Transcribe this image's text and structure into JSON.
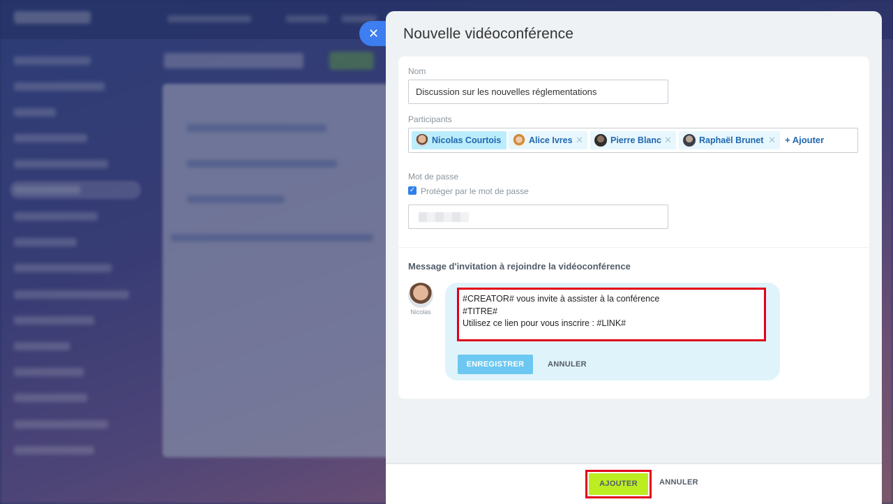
{
  "window": {
    "title": "Nouvelle vidéoconférence"
  },
  "form": {
    "name_label": "Nom",
    "name_value": "Discussion sur les nouvelles réglementations",
    "participants_label": "Participants",
    "participants": [
      {
        "name": "Nicolas Courtois",
        "highlighted": true
      },
      {
        "name": "Alice Ivres",
        "highlighted": false
      },
      {
        "name": "Pierre Blanc",
        "highlighted": false
      },
      {
        "name": "Raphaël Brunet",
        "highlighted": false
      }
    ],
    "add_participant": "+ Ajouter",
    "password_label": "Mot de passe",
    "password_checkbox_label": "Protéger par le mot de passe",
    "password_checked": true
  },
  "invitation": {
    "heading": "Message d'invitation à rejoindre la vidéoconférence",
    "author_name": "Nicolas",
    "message_lines": [
      "#CREATOR# vous invite à assister à la conférence",
      "#TITRE#",
      "Utilisez ce lien pour vous inscrire : #LINK#"
    ],
    "save_label": "ENREGISTRER",
    "cancel_label": "ANNULER"
  },
  "footer": {
    "add_label": "AJOUTER",
    "cancel_label": "ANNULER"
  },
  "colors": {
    "accent_blue": "#3d7ef0",
    "add_button": "#bbed21",
    "highlight_red": "#e0001a",
    "chip_bg": "#bcedfc"
  },
  "icons": {
    "close": "close-icon",
    "checkbox": "checkmark-icon",
    "chip_remove": "close-icon"
  }
}
